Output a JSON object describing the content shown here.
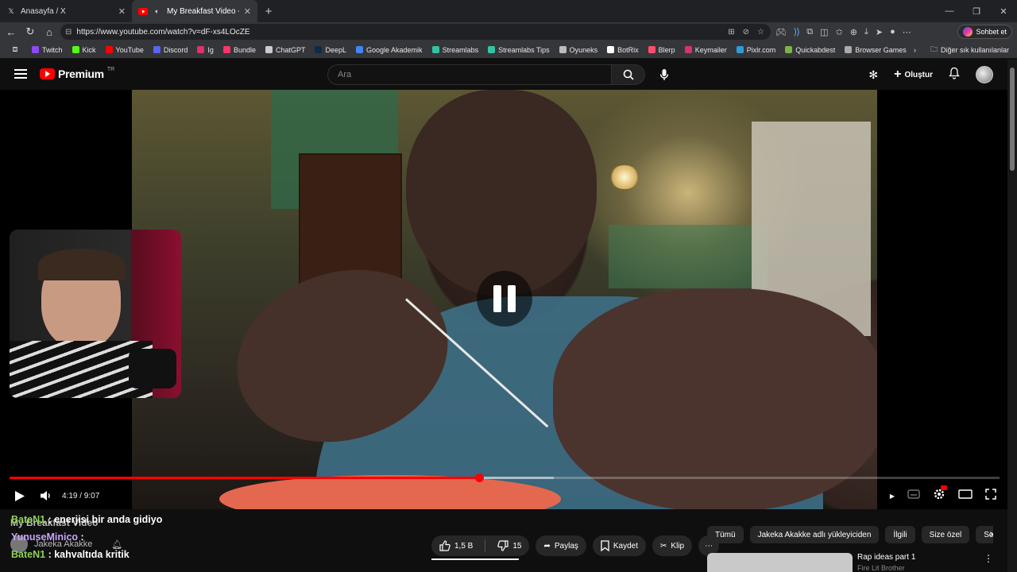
{
  "browser": {
    "tabs": [
      {
        "title": "Anasayfa / X",
        "favicon": "x-logo-icon"
      },
      {
        "title": "My Breakfast Video - YouTube",
        "favicon": "youtube-icon"
      }
    ],
    "url": "https://www.youtube.com/watch?v=dF-xs4LOcZE",
    "chat_button": "Sohbet et",
    "bookmarks": [
      {
        "label": "Twitch",
        "color": "#9146ff"
      },
      {
        "label": "Kick",
        "color": "#53fc18"
      },
      {
        "label": "YouTube",
        "color": "#ff0000"
      },
      {
        "label": "Discord",
        "color": "#5865f2"
      },
      {
        "label": "Ig",
        "color": "#e1306c"
      },
      {
        "label": "Bundle",
        "color": "#ff3366"
      },
      {
        "label": "ChatGPT",
        "color": "#cccccc"
      },
      {
        "label": "DeepL",
        "color": "#0f2b46"
      },
      {
        "label": "Google Akademik",
        "color": "#4285f4"
      },
      {
        "label": "Streamlabs",
        "color": "#31c3a2"
      },
      {
        "label": "Streamlabs Tips",
        "color": "#31c3a2"
      },
      {
        "label": "Oyuneks",
        "color": "#bbbbbb"
      },
      {
        "label": "BotRix",
        "color": "#ffffff"
      },
      {
        "label": "Blerp",
        "color": "#ff4d6d"
      },
      {
        "label": "Keymailer",
        "color": "#d6336c"
      },
      {
        "label": "Pixlr.com",
        "color": "#2d9cdb"
      },
      {
        "label": "Quickabdest",
        "color": "#7cb342"
      },
      {
        "label": "Browser Games",
        "color": "#aaaaaa"
      }
    ],
    "other_bookmarks": "Diğer sık kullanılanlar"
  },
  "youtube": {
    "logo_word": "Premium",
    "region": "TR",
    "search_placeholder": "Ara",
    "create_label": "Oluştur"
  },
  "player": {
    "time": "4:19 / 9:07",
    "progress": 0.4747,
    "buffered": 0.55
  },
  "video_info": {
    "title": "My Breakfast Video",
    "channel": "Jakeka Akakke"
  },
  "chat": [
    {
      "user": "BateN1",
      "message": ": enerjisi bir anda gidiyo"
    },
    {
      "user": "YunuseMinico",
      "message": ":"
    },
    {
      "user": "BateN1",
      "message": ": kahvaltıda kritik"
    }
  ],
  "actions": {
    "likes": "1,5 B",
    "dislikes": "15",
    "share": "Paylaş",
    "save": "Kaydet",
    "clip": "Klip"
  },
  "chips": [
    "Tümü",
    "Jakeka Akakke adlı yükleyiciden",
    "İlgili",
    "Size özel",
    "Son y"
  ],
  "recommendation": {
    "title": "Rap ideas part 1",
    "subtitle": "Fire Lit Brother"
  }
}
